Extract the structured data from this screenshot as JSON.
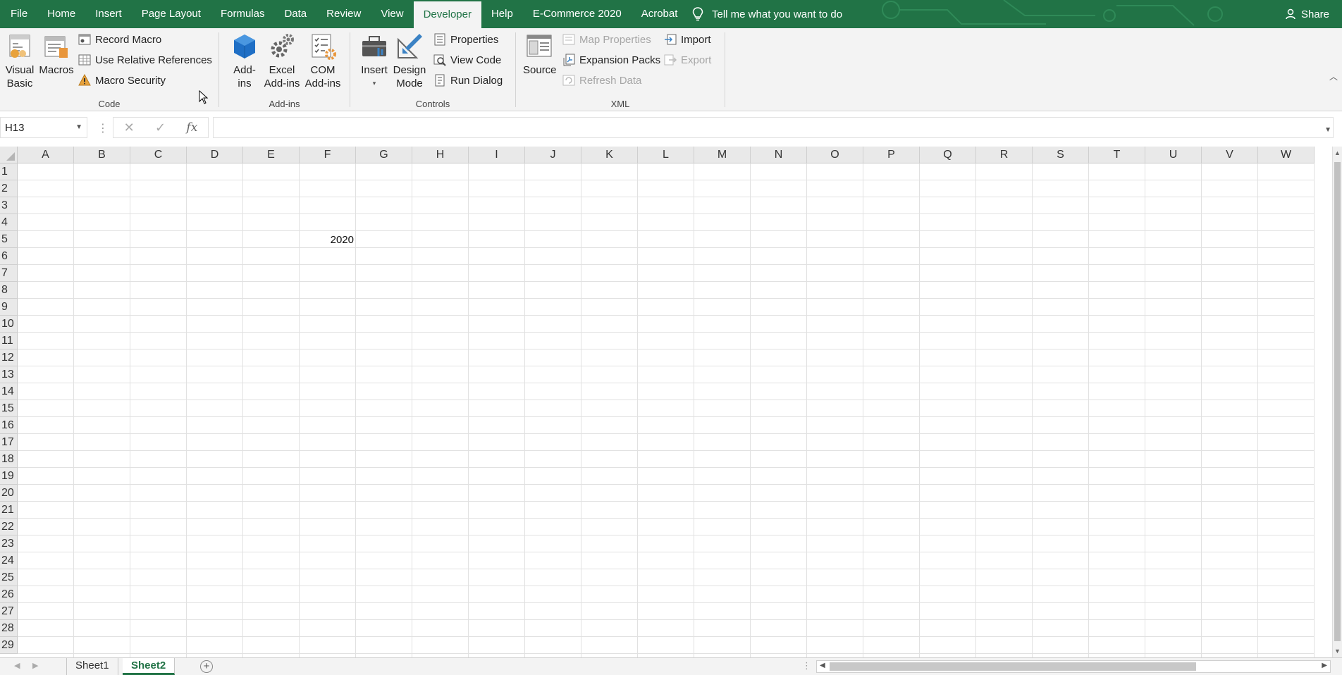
{
  "menu": {
    "tabs": [
      "File",
      "Home",
      "Insert",
      "Page Layout",
      "Formulas",
      "Data",
      "Review",
      "View",
      "Developer",
      "Help",
      "E-Commerce 2020",
      "Acrobat"
    ],
    "active_tab": "Developer",
    "tell_me": "Tell me what you want to do",
    "share": "Share"
  },
  "ribbon": {
    "code": {
      "label": "Code",
      "visual_basic": "Visual Basic",
      "visual_basic_l1": "Visual",
      "visual_basic_l2": "Basic",
      "macros": "Macros",
      "record_macro": "Record Macro",
      "use_relative_references": "Use Relative References",
      "macro_security": "Macro Security"
    },
    "addins": {
      "label": "Add-ins",
      "addins_l1": "Add-",
      "addins_l2": "ins",
      "excel_addins_l1": "Excel",
      "excel_addins_l2": "Add-ins",
      "com_addins_l1": "COM",
      "com_addins_l2": "Add-ins"
    },
    "controls": {
      "label": "Controls",
      "insert": "Insert",
      "design_mode_l1": "Design",
      "design_mode_l2": "Mode",
      "properties": "Properties",
      "view_code": "View Code",
      "run_dialog": "Run Dialog"
    },
    "xml": {
      "label": "XML",
      "source": "Source",
      "map_properties": "Map Properties",
      "expansion_packs": "Expansion Packs",
      "refresh_data": "Refresh Data",
      "import": "Import",
      "export": "Export"
    }
  },
  "formula_bar": {
    "name_box": "H13",
    "fx": "fx",
    "formula": ""
  },
  "grid": {
    "columns": [
      "A",
      "B",
      "C",
      "D",
      "E",
      "F",
      "G",
      "H",
      "I",
      "J",
      "K",
      "L",
      "M",
      "N",
      "O",
      "P",
      "Q",
      "R",
      "S",
      "T",
      "U",
      "V",
      "W"
    ],
    "rows": [
      "1",
      "2",
      "3",
      "4",
      "5",
      "6",
      "7",
      "8",
      "9",
      "10",
      "11",
      "12",
      "13",
      "14",
      "15",
      "16",
      "17",
      "18",
      "19",
      "20",
      "21",
      "22",
      "23",
      "24",
      "25",
      "26",
      "27",
      "28",
      "29"
    ],
    "cells": [
      {
        "ref": "F5",
        "col": 5,
        "row": 4,
        "value": "2020"
      }
    ]
  },
  "sheets": {
    "tabs": [
      "Sheet1",
      "Sheet2"
    ],
    "active": "Sheet2",
    "add_symbol": "+"
  },
  "colors": {
    "brand_green": "#217346",
    "ribbon_bg": "#f3f3f3"
  }
}
